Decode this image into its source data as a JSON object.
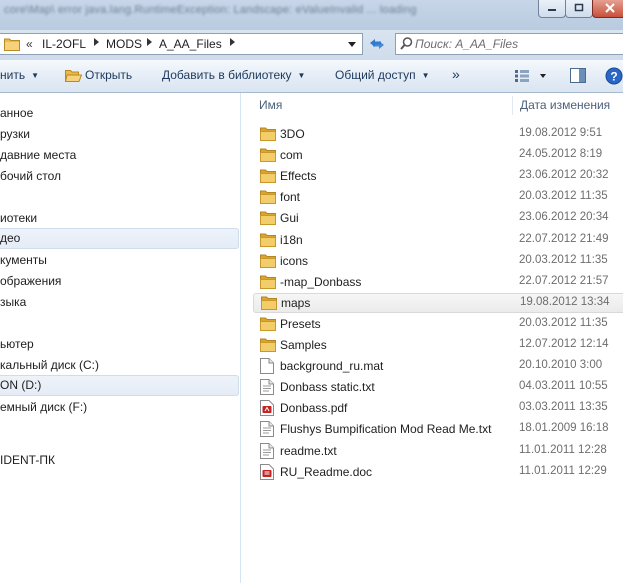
{
  "window": {
    "title": "core\\Map\\ error java.lang.RuntimeException: Landscape: eValueInvalid ... loading"
  },
  "address": {
    "lead": "«",
    "crumbs": [
      "IL-2OFL",
      "MODS",
      "A_AA_Files"
    ],
    "separator": "▶"
  },
  "search": {
    "placeholder": "Поиск: A_AA_Files"
  },
  "toolbar": {
    "organize_label": "нить",
    "open_label": "Открыть",
    "add_library_label": "Добавить в библиотеку",
    "share_label": "Общий доступ",
    "more_label": "»"
  },
  "nav": {
    "items": [
      {
        "label": "анное"
      },
      {
        "label": "рузки"
      },
      {
        "label": "давние места"
      },
      {
        "label": "бочий стол"
      },
      {
        "label": "иотеки"
      },
      {
        "label": "део"
      },
      {
        "label": "кументы"
      },
      {
        "label": "ображения"
      },
      {
        "label": "зыка"
      },
      {
        "label": "ьютер"
      },
      {
        "label": "кальный диск (C:)"
      },
      {
        "label": "ON (D:)"
      },
      {
        "label": "емный диск (F:)"
      },
      {
        "label": "IDENT-ПК"
      }
    ]
  },
  "filelist": {
    "col_name": "Имя",
    "col_date": "Дата изменения",
    "rows": [
      {
        "name": "3DO",
        "date": "19.08.2012 9:51",
        "icon": "folder-icon"
      },
      {
        "name": "com",
        "date": "24.05.2012 8:19",
        "icon": "folder-icon"
      },
      {
        "name": "Effects",
        "date": "23.06.2012 20:32",
        "icon": "folder-icon"
      },
      {
        "name": "font",
        "date": "20.03.2012 11:35",
        "icon": "folder-icon"
      },
      {
        "name": "Gui",
        "date": "23.06.2012 20:34",
        "icon": "folder-icon"
      },
      {
        "name": "i18n",
        "date": "22.07.2012 21:49",
        "icon": "folder-icon"
      },
      {
        "name": "icons",
        "date": "20.03.2012 11:35",
        "icon": "folder-icon"
      },
      {
        "name": "-map_Donbass",
        "date": "22.07.2012 21:57",
        "icon": "folder-icon"
      },
      {
        "name": "maps",
        "date": "19.08.2012 13:34",
        "icon": "folder-icon"
      },
      {
        "name": "Presets",
        "date": "20.03.2012 11:35",
        "icon": "folder-icon"
      },
      {
        "name": "Samples",
        "date": "12.07.2012 12:14",
        "icon": "folder-icon"
      },
      {
        "name": "background_ru.mat",
        "date": "20.10.2010 3:00",
        "icon": "file-icon"
      },
      {
        "name": "Donbass static.txt",
        "date": "04.03.2011 10:55",
        "icon": "text-file-icon"
      },
      {
        "name": "Donbass.pdf",
        "date": "03.03.2011 13:35",
        "icon": "pdf-file-icon"
      },
      {
        "name": "Flushys Bumpification Mod Read Me.txt",
        "date": "18.01.2009 16:18",
        "icon": "text-file-icon"
      },
      {
        "name": "readme.txt",
        "date": "11.01.2011 12:28",
        "icon": "text-file-icon"
      },
      {
        "name": "RU_Readme.doc",
        "date": "11.01.2011 12:29",
        "icon": "doc-file-icon"
      }
    ]
  },
  "colors": {
    "folder": "#e9b949",
    "accent": "#1e395b",
    "pdf": "#c22323"
  }
}
